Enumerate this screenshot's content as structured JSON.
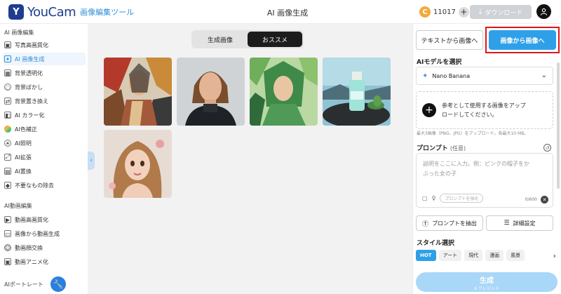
{
  "app": {
    "logo_text": "YouCam",
    "subtitle": "画像編集ツール",
    "page_title": "AI 画像生成",
    "credits": "11017",
    "download_label": "ダウンロード"
  },
  "sidebar": {
    "ai_image_title": "AI 画像編集",
    "ai_image_items": [
      {
        "label": "写真高画質化",
        "icon": "enhance-icon"
      },
      {
        "label": "AI 画像生成",
        "icon": "image-gen-icon"
      },
      {
        "label": "背景透明化",
        "icon": "transparent-bg-icon"
      },
      {
        "label": "背景ぼかし",
        "icon": "blur-bg-icon"
      },
      {
        "label": "背景置き換え",
        "icon": "replace-bg-icon"
      },
      {
        "label": "AI カラー化",
        "icon": "colorize-icon"
      },
      {
        "label": "AI色補正",
        "icon": "color-correct-icon"
      },
      {
        "label": "AI照明",
        "icon": "lighting-icon"
      },
      {
        "label": "AI拡張",
        "icon": "expand-icon"
      },
      {
        "label": "AI置換",
        "icon": "replace-icon"
      },
      {
        "label": "不要なもの除去",
        "icon": "eraser-icon"
      }
    ],
    "ai_video_title": "AI動画編集",
    "ai_video_items": [
      {
        "label": "動画高画質化",
        "icon": "video-enhance-icon"
      },
      {
        "label": "画像から動画生成",
        "icon": "image-to-video-icon"
      },
      {
        "label": "動画顔交換",
        "icon": "face-swap-icon"
      },
      {
        "label": "動画アニメ化",
        "icon": "anime-video-icon"
      }
    ],
    "portrait_title": "AIポートレート"
  },
  "main": {
    "toggle": {
      "generated": "生成画像",
      "recommended": "おススメ"
    }
  },
  "panel": {
    "tab_text_to_image": "テキストから画像へ",
    "tab_image_to_image": "画像から画像へ",
    "model_label": "AIモデルを選択",
    "model_value": "Nano Banana",
    "upload_text_1": "参考として使用する画像をアップ",
    "upload_text_2": "ロードしてください。",
    "upload_note": "最大3画像（PNG、JPG）をアップロード。各最大10 MB。",
    "prompt_label": "プロンプト",
    "prompt_optional": "(任意)",
    "prompt_placeholder_1": "説明をここに入力。例：ピンクの帽子をか",
    "prompt_placeholder_2": "ぶった女の子",
    "prompt_chip": "プロンプトを強化",
    "prompt_counter": "0/600",
    "extract_prompt": "プロンプトを抽出",
    "advanced_settings": "詳細設定",
    "style_label": "スタイル選択",
    "styles": [
      "HOT",
      "アート",
      "現代",
      "漫画",
      "風景"
    ],
    "generate_label": "生成",
    "generate_cost": "4 クレジット"
  },
  "colors": {
    "accent": "#2fa0e8",
    "brand": "#1f3d8f",
    "highlight_frame": "#e0161b"
  }
}
